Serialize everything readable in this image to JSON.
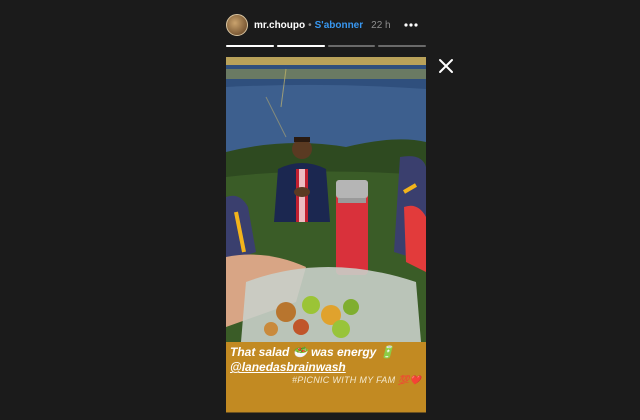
{
  "header": {
    "username": "mr.choupo",
    "separator": "•",
    "follow_label": "S'abonner",
    "time_ago": "22 h"
  },
  "progress": {
    "segments": 4,
    "current_index": 1,
    "current_fill": 1.0
  },
  "caption": {
    "line1": "That salad 🥗 was energy 🔋",
    "line2": "@lanedasbrainwash",
    "line3": "#PICNIC WITH MY FAM 💯❤️",
    "background": "#c28a22"
  },
  "icons": {
    "more": "more-horizontal-icon",
    "close": "close-icon"
  },
  "colors": {
    "background": "#1b1b1b",
    "follow": "#3897f0"
  }
}
